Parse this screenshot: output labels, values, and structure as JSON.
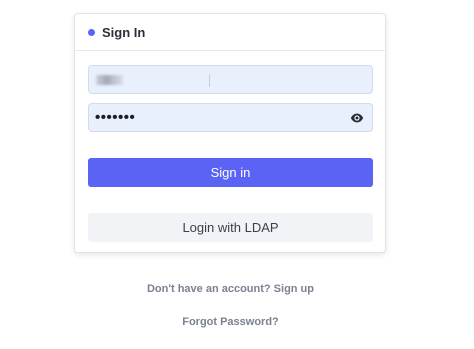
{
  "card": {
    "title": "Sign In",
    "accent_color": "#5b63f5"
  },
  "form": {
    "username_value": "",
    "password_value": "•••••••",
    "password_toggle_icon": "eye-icon"
  },
  "buttons": {
    "signin_label": "Sign in",
    "ldap_label": "Login with LDAP"
  },
  "links": {
    "signup_text": "Don't have an account? Sign up",
    "forgot_text": "Forgot Password?"
  }
}
